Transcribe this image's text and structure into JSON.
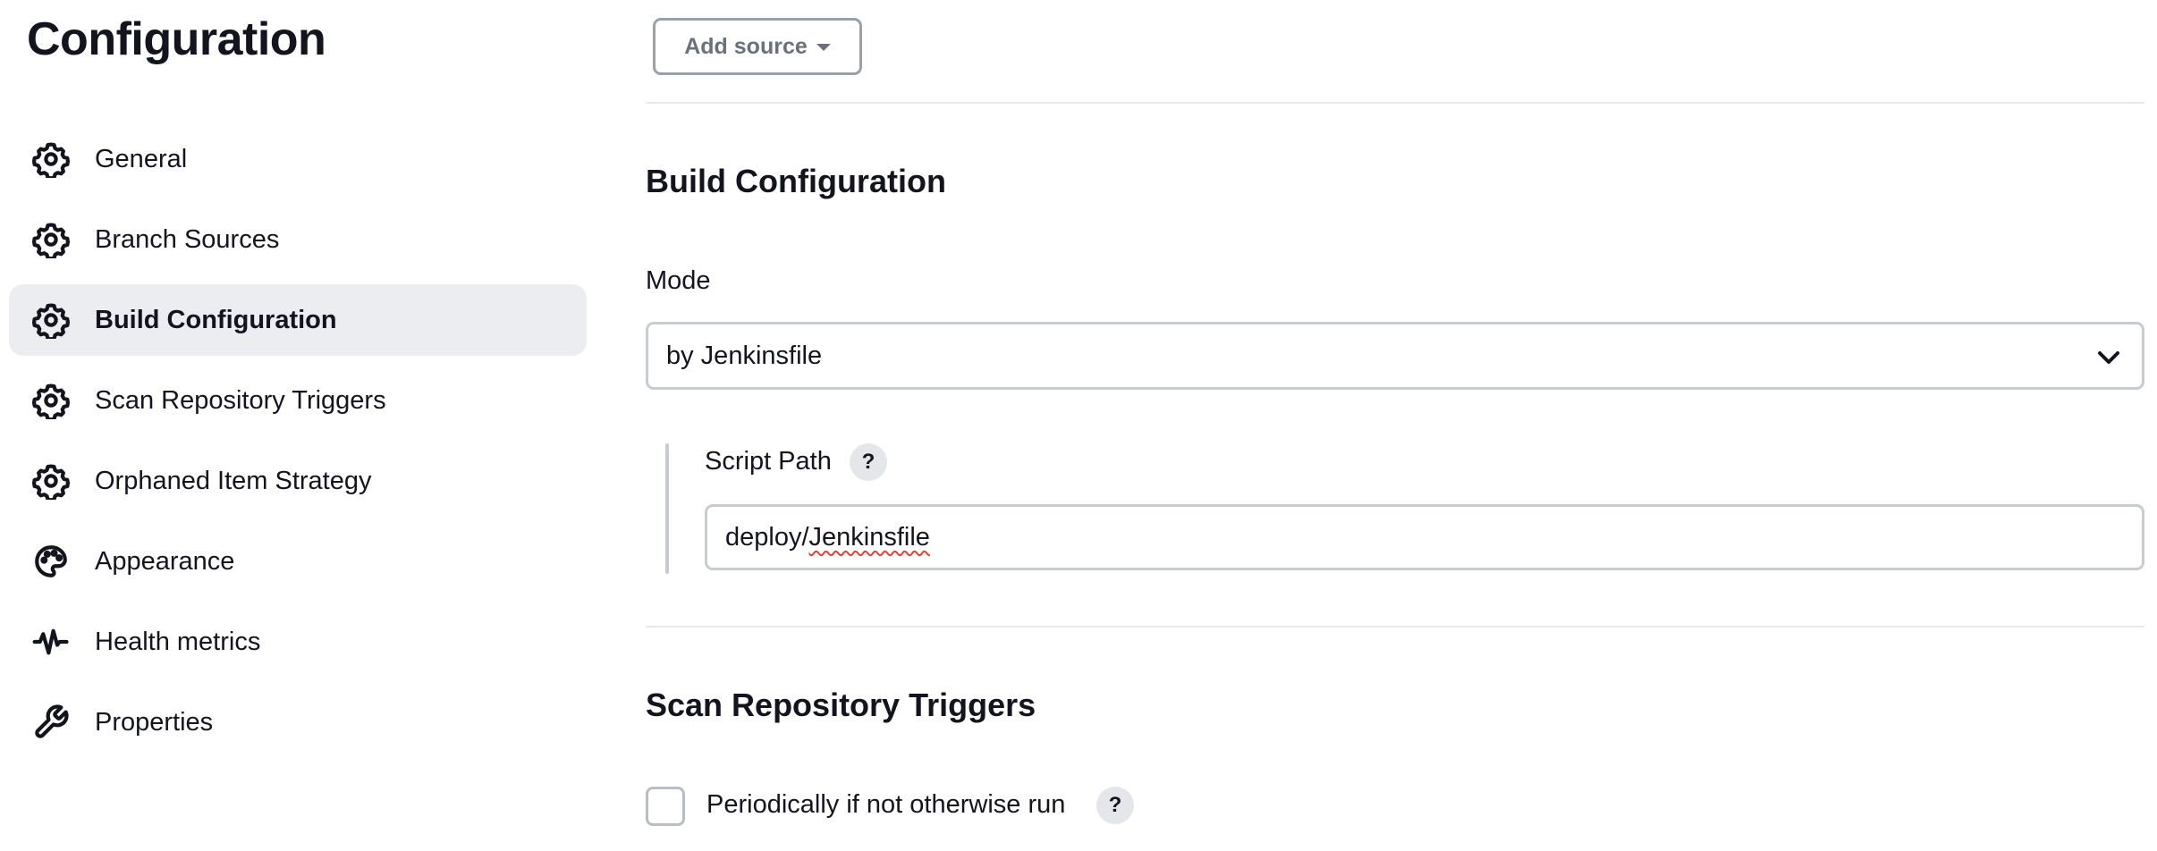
{
  "page": {
    "title": "Configuration"
  },
  "sidebar": {
    "items": [
      {
        "label": "General",
        "icon": "gear-icon",
        "active": false
      },
      {
        "label": "Branch Sources",
        "icon": "gear-icon",
        "active": false
      },
      {
        "label": "Build Configuration",
        "icon": "gear-icon",
        "active": true
      },
      {
        "label": "Scan Repository Triggers",
        "icon": "gear-icon",
        "active": false
      },
      {
        "label": "Orphaned Item Strategy",
        "icon": "gear-icon",
        "active": false
      },
      {
        "label": "Appearance",
        "icon": "palette-icon",
        "active": false
      },
      {
        "label": "Health metrics",
        "icon": "pulse-icon",
        "active": false
      },
      {
        "label": "Properties",
        "icon": "wrench-icon",
        "active": false
      }
    ]
  },
  "branch_sources": {
    "add_source_label": "Add source"
  },
  "build_configuration": {
    "title": "Build Configuration",
    "mode_label": "Mode",
    "mode_value": "by Jenkinsfile",
    "script_path_label": "Script Path",
    "script_path_value_prefix": "deploy/",
    "script_path_value_word": "Jenkinsfile",
    "help_glyph": "?"
  },
  "scan_triggers": {
    "title": "Scan Repository Triggers",
    "periodic_label": "Periodically if not otherwise run",
    "periodic_checked": false,
    "help_glyph": "?"
  }
}
